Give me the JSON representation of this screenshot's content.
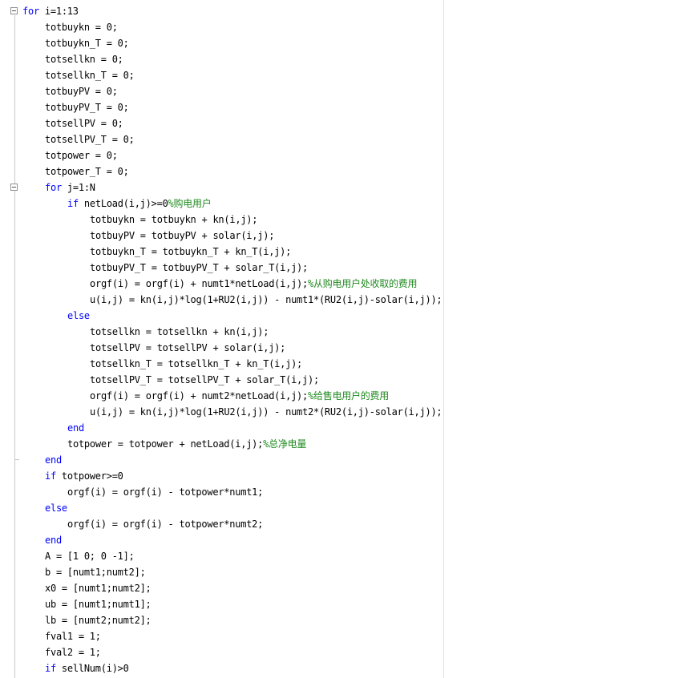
{
  "colors": {
    "keyword": "#0000ff",
    "comment": "#228b22",
    "text": "#000000",
    "fold_guide": "#c8c8c8",
    "right_margin": "#e0e0e0"
  },
  "icons": {
    "fold_toggle": "minus-box-icon"
  },
  "lines": [
    [
      {
        "t": "for",
        "k": "kw"
      },
      {
        "t": " i=1:13"
      }
    ],
    [
      {
        "t": "totbuykn = 0;"
      }
    ],
    [
      {
        "t": "totbuykn_T = 0;"
      }
    ],
    [
      {
        "t": "totsellkn = 0;"
      }
    ],
    [
      {
        "t": "totsellkn_T = 0;"
      }
    ],
    [
      {
        "t": "totbuyPV = 0;"
      }
    ],
    [
      {
        "t": "totbuyPV_T = 0;"
      }
    ],
    [
      {
        "t": "totsellPV = 0;"
      }
    ],
    [
      {
        "t": "totsellPV_T = 0;"
      }
    ],
    [
      {
        "t": "totpower = 0;"
      }
    ],
    [
      {
        "t": "totpower_T = 0;"
      }
    ],
    [
      {
        "t": "for",
        "k": "kw"
      },
      {
        "t": " j=1:N"
      }
    ],
    [
      {
        "t": "if",
        "k": "kw"
      },
      {
        "t": " netLoad(i,j)>=0"
      },
      {
        "t": "%购电用户",
        "k": "cm"
      }
    ],
    [
      {
        "t": "totbuykn = totbuykn + kn(i,j);"
      }
    ],
    [
      {
        "t": "totbuyPV = totbuyPV + solar(i,j);"
      }
    ],
    [
      {
        "t": "totbuykn_T = totbuykn_T + kn_T(i,j);"
      }
    ],
    [
      {
        "t": "totbuyPV_T = totbuyPV_T + solar_T(i,j);"
      }
    ],
    [
      {
        "t": "orgf(i) = orgf(i) + numt1*netLoad(i,j);"
      },
      {
        "t": "%从购电用户处收取的费用",
        "k": "cm"
      }
    ],
    [
      {
        "t": "u(i,j) = kn(i,j)*log(1+RU2(i,j)) - numt1*(RU2(i,j)-solar(i,j));"
      }
    ],
    [
      {
        "t": "else",
        "k": "kw"
      }
    ],
    [
      {
        "t": "totsellkn = totsellkn + kn(i,j);"
      }
    ],
    [
      {
        "t": "totsellPV = totsellPV + solar(i,j);"
      }
    ],
    [
      {
        "t": "totsellkn_T = totsellkn_T + kn_T(i,j);"
      }
    ],
    [
      {
        "t": "totsellPV_T = totsellPV_T + solar_T(i,j);"
      }
    ],
    [
      {
        "t": "orgf(i) = orgf(i) + numt2*netLoad(i,j);"
      },
      {
        "t": "%给售电用户的费用",
        "k": "cm"
      }
    ],
    [
      {
        "t": "u(i,j) = kn(i,j)*log(1+RU2(i,j)) - numt2*(RU2(i,j)-solar(i,j));"
      }
    ],
    [
      {
        "t": "end",
        "k": "kw"
      }
    ],
    [
      {
        "t": "totpower = totpower + netLoad(i,j);"
      },
      {
        "t": "%总净电量",
        "k": "cm"
      }
    ],
    [
      {
        "t": "end",
        "k": "kw"
      }
    ],
    [
      {
        "t": "if",
        "k": "kw"
      },
      {
        "t": " totpower>=0"
      }
    ],
    [
      {
        "t": "orgf(i) = orgf(i) - totpower*numt1;"
      }
    ],
    [
      {
        "t": "else",
        "k": "kw"
      }
    ],
    [
      {
        "t": "orgf(i) = orgf(i) - totpower*numt2;"
      }
    ],
    [
      {
        "t": "end",
        "k": "kw"
      }
    ],
    [
      {
        "t": "A = [1 0; 0 -1];"
      }
    ],
    [
      {
        "t": "b = [numt1;numt2];"
      }
    ],
    [
      {
        "t": "x0 = [numt1;numt2];"
      }
    ],
    [
      {
        "t": "ub = [numt1;numt1];"
      }
    ],
    [
      {
        "t": "lb = [numt2;numt2];"
      }
    ],
    [
      {
        "t": "fval1 = 1;"
      }
    ],
    [
      {
        "t": "fval2 = 1;"
      }
    ],
    [
      {
        "t": "if",
        "k": "kw"
      },
      {
        "t": " sellNum(i)>0"
      }
    ]
  ]
}
